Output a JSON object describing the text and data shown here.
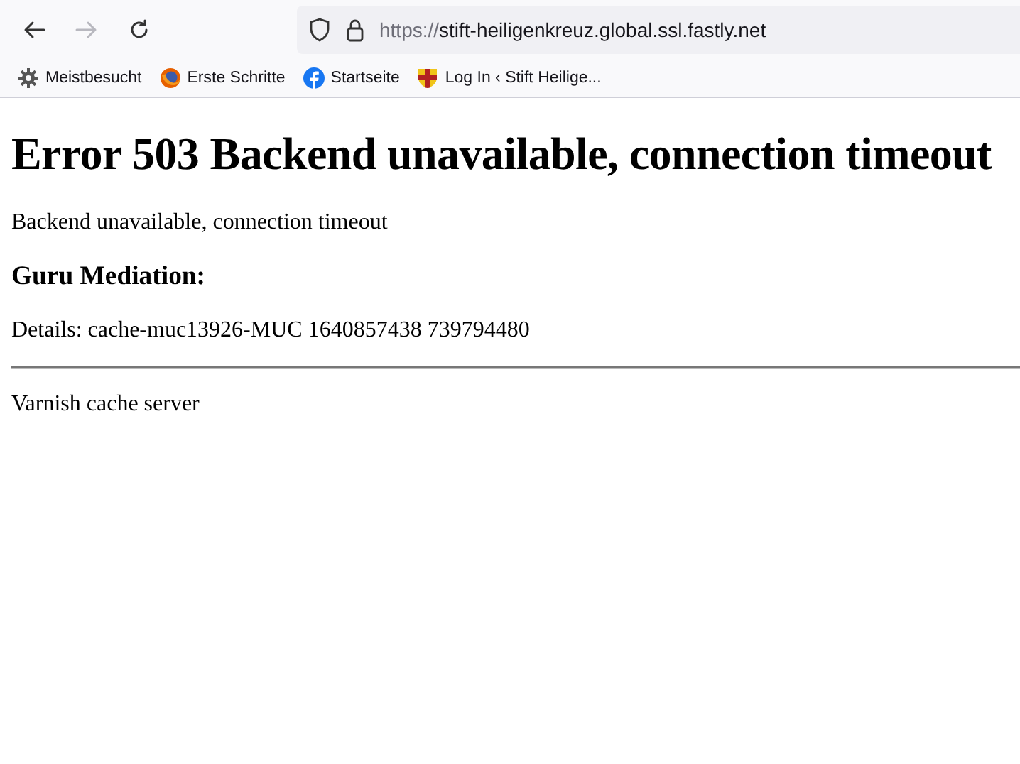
{
  "toolbar": {
    "buttons": [
      {
        "kind": "back",
        "disabled": false
      },
      {
        "kind": "forward",
        "disabled": true
      },
      {
        "kind": "reload",
        "disabled": false
      }
    ],
    "address": {
      "scheme": "https://",
      "host": "stift-heiligenkreuz.global.ssl.fastly.net"
    }
  },
  "bookmarks": [
    {
      "kind": "gear",
      "label": "Meistbesucht"
    },
    {
      "kind": "firefox",
      "label": "Erste Schritte"
    },
    {
      "kind": "facebook",
      "label": "Startseite"
    },
    {
      "kind": "crest",
      "label": "Log In ‹ Stift Heilige..."
    }
  ],
  "page": {
    "heading": "Error 503 Backend unavailable, connection timeout",
    "message": "Backend unavailable, connection timeout",
    "subheading": "Guru Mediation:",
    "details": "Details: cache-muc13926-MUC 1640857438 739794480",
    "footer": "Varnish cache server"
  }
}
